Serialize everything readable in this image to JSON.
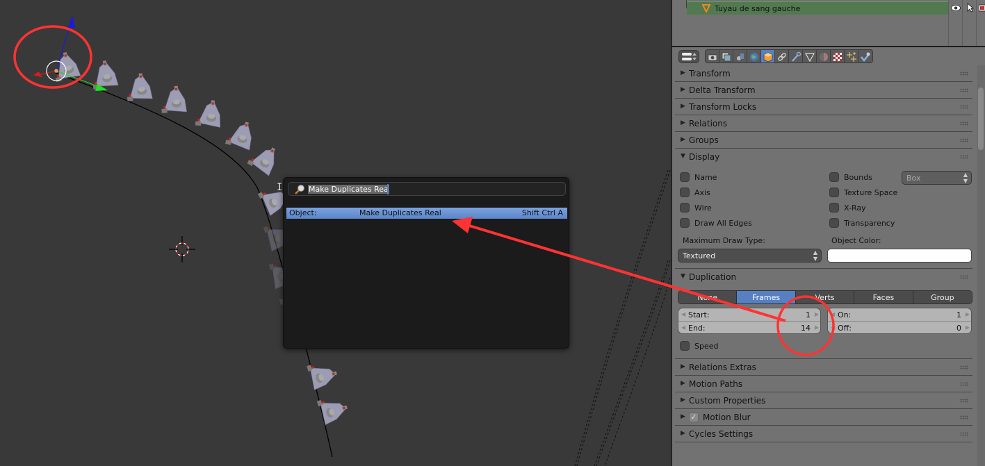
{
  "viewport": {
    "name": "3D Viewport",
    "duplicate_count_visible": 14
  },
  "outliner": {
    "selected_item": "Tuyau de sang gauche",
    "item_icon": "curve-object-icon",
    "column_icons": [
      "eye-icon",
      "cursor-select-icon",
      "render-camera-icon"
    ]
  },
  "properties": {
    "context_tabs": [
      {
        "icon": "render-icon",
        "active": false
      },
      {
        "icon": "render-layers-icon",
        "active": false
      },
      {
        "icon": "scene-icon",
        "active": false
      },
      {
        "icon": "world-icon",
        "active": false
      },
      {
        "icon": "object-icon",
        "active": true
      },
      {
        "icon": "constraints-icon",
        "active": false
      },
      {
        "icon": "modifiers-icon",
        "active": false
      },
      {
        "icon": "data-icon",
        "active": false
      },
      {
        "icon": "material-icon",
        "active": false
      },
      {
        "icon": "texture-icon",
        "active": false
      },
      {
        "icon": "particles-icon",
        "active": false
      },
      {
        "icon": "physics-icon",
        "active": false
      }
    ],
    "panels_top": [
      {
        "label": "Transform",
        "expanded": false
      },
      {
        "label": "Delta Transform",
        "expanded": false
      },
      {
        "label": "Transform Locks",
        "expanded": false
      },
      {
        "label": "Relations",
        "expanded": false
      },
      {
        "label": "Groups",
        "expanded": false
      }
    ],
    "display": {
      "label": "Display",
      "expanded": true,
      "left_checks": [
        {
          "label": "Name",
          "checked": false
        },
        {
          "label": "Axis",
          "checked": false
        },
        {
          "label": "Wire",
          "checked": false
        },
        {
          "label": "Draw All Edges",
          "checked": false
        }
      ],
      "right_checks": [
        {
          "label": "Bounds",
          "checked": false
        },
        {
          "label": "Texture Space",
          "checked": false
        },
        {
          "label": "X-Ray",
          "checked": false
        },
        {
          "label": "Transparency",
          "checked": false
        }
      ],
      "bounds_type": "Box",
      "max_draw_type_label": "Maximum Draw Type:",
      "max_draw_type_value": "Textured",
      "object_color_label": "Object Color:",
      "object_color": "#ffffff"
    },
    "duplication": {
      "label": "Duplication",
      "expanded": true,
      "modes": [
        "None",
        "Frames",
        "Verts",
        "Faces",
        "Group"
      ],
      "active_mode": "Frames",
      "start_label": "Start:",
      "start_value": "1",
      "end_label": "End:",
      "end_value": "14",
      "on_label": "On:",
      "on_value": "1",
      "off_label": "Off:",
      "off_value": "0",
      "speed_label": "Speed",
      "speed_checked": false
    },
    "panels_bottom": [
      {
        "label": "Relations Extras",
        "expanded": false,
        "has_checkbox": false
      },
      {
        "label": "Motion Paths",
        "expanded": false,
        "has_checkbox": false
      },
      {
        "label": "Custom Properties",
        "expanded": false,
        "has_checkbox": false
      },
      {
        "label": "Motion Blur",
        "expanded": false,
        "has_checkbox": true,
        "checked": true
      },
      {
        "label": "Cycles Settings",
        "expanded": false,
        "has_checkbox": false
      }
    ]
  },
  "search_popup": {
    "query": "Make Duplicates Rea",
    "results": [
      {
        "category": "Object:",
        "name": "Make Duplicates Real",
        "shortcut": "Shift Ctrl A"
      }
    ]
  },
  "annotations": {
    "color": "#ff3333"
  }
}
